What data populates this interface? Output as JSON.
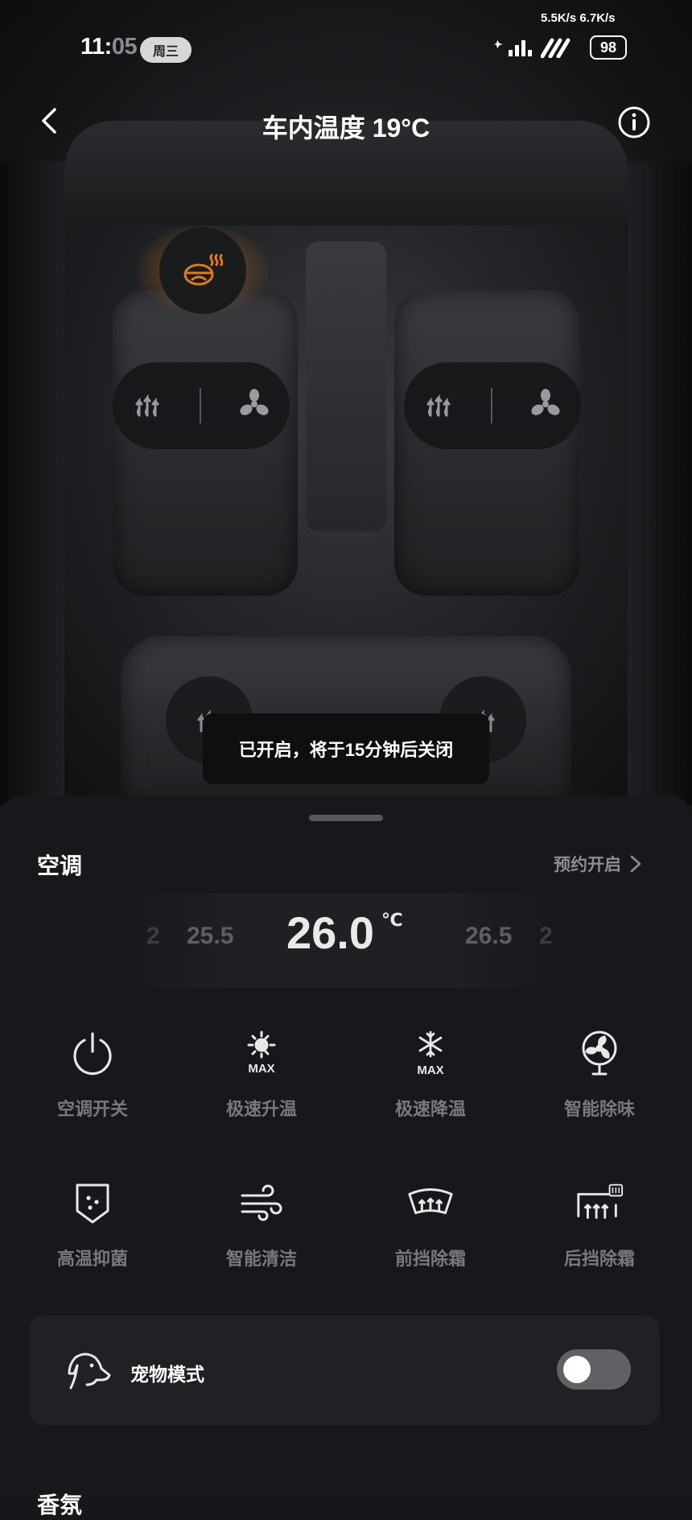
{
  "status_bar": {
    "time_hour": "11:",
    "time_min": "05",
    "day": "周三",
    "net_speed": "5.5K/s 6.7K/s",
    "battery": "98"
  },
  "header": {
    "title": "车内温度  19°C",
    "back_icon": "chevron-left-icon",
    "info_icon": "info-circle-icon"
  },
  "car": {
    "steering_heat_icon": "steering-wheel-heat-icon",
    "steering_heat_color": "#e07a1f",
    "front_left": {
      "heat_icon": "seat-heat-icon",
      "vent_icon": "seat-ventilation-icon"
    },
    "front_right": {
      "heat_icon": "seat-heat-icon",
      "vent_icon": "seat-ventilation-icon"
    },
    "rear_left_icon": "seat-heat-icon",
    "rear_right_icon": "seat-heat-icon"
  },
  "toast": "已开启，将于15分钟后关闭",
  "ac": {
    "title": "空调",
    "schedule_label": "预约开启",
    "temp_prev": "25.5",
    "temp_current": "26.0",
    "temp_unit": "℃",
    "temp_next": "26.5",
    "temp_far_prev": "2",
    "temp_far_next": "2",
    "functions": [
      {
        "label": "空调开关",
        "icon": "power-icon"
      },
      {
        "label": "极速升温",
        "icon": "sun-max-icon"
      },
      {
        "label": "极速降温",
        "icon": "snowflake-max-icon"
      },
      {
        "label": "智能除味",
        "icon": "fan-circle-icon"
      },
      {
        "label": "高温抑菌",
        "icon": "shield-dots-icon"
      },
      {
        "label": "智能清洁",
        "icon": "wind-icon"
      },
      {
        "label": "前挡除霜",
        "icon": "front-defrost-icon"
      },
      {
        "label": "后挡除霜",
        "icon": "rear-defrost-icon"
      }
    ]
  },
  "pet_mode": {
    "label": "宠物模式",
    "icon": "dog-icon",
    "enabled": false
  },
  "next_section": "香氛"
}
